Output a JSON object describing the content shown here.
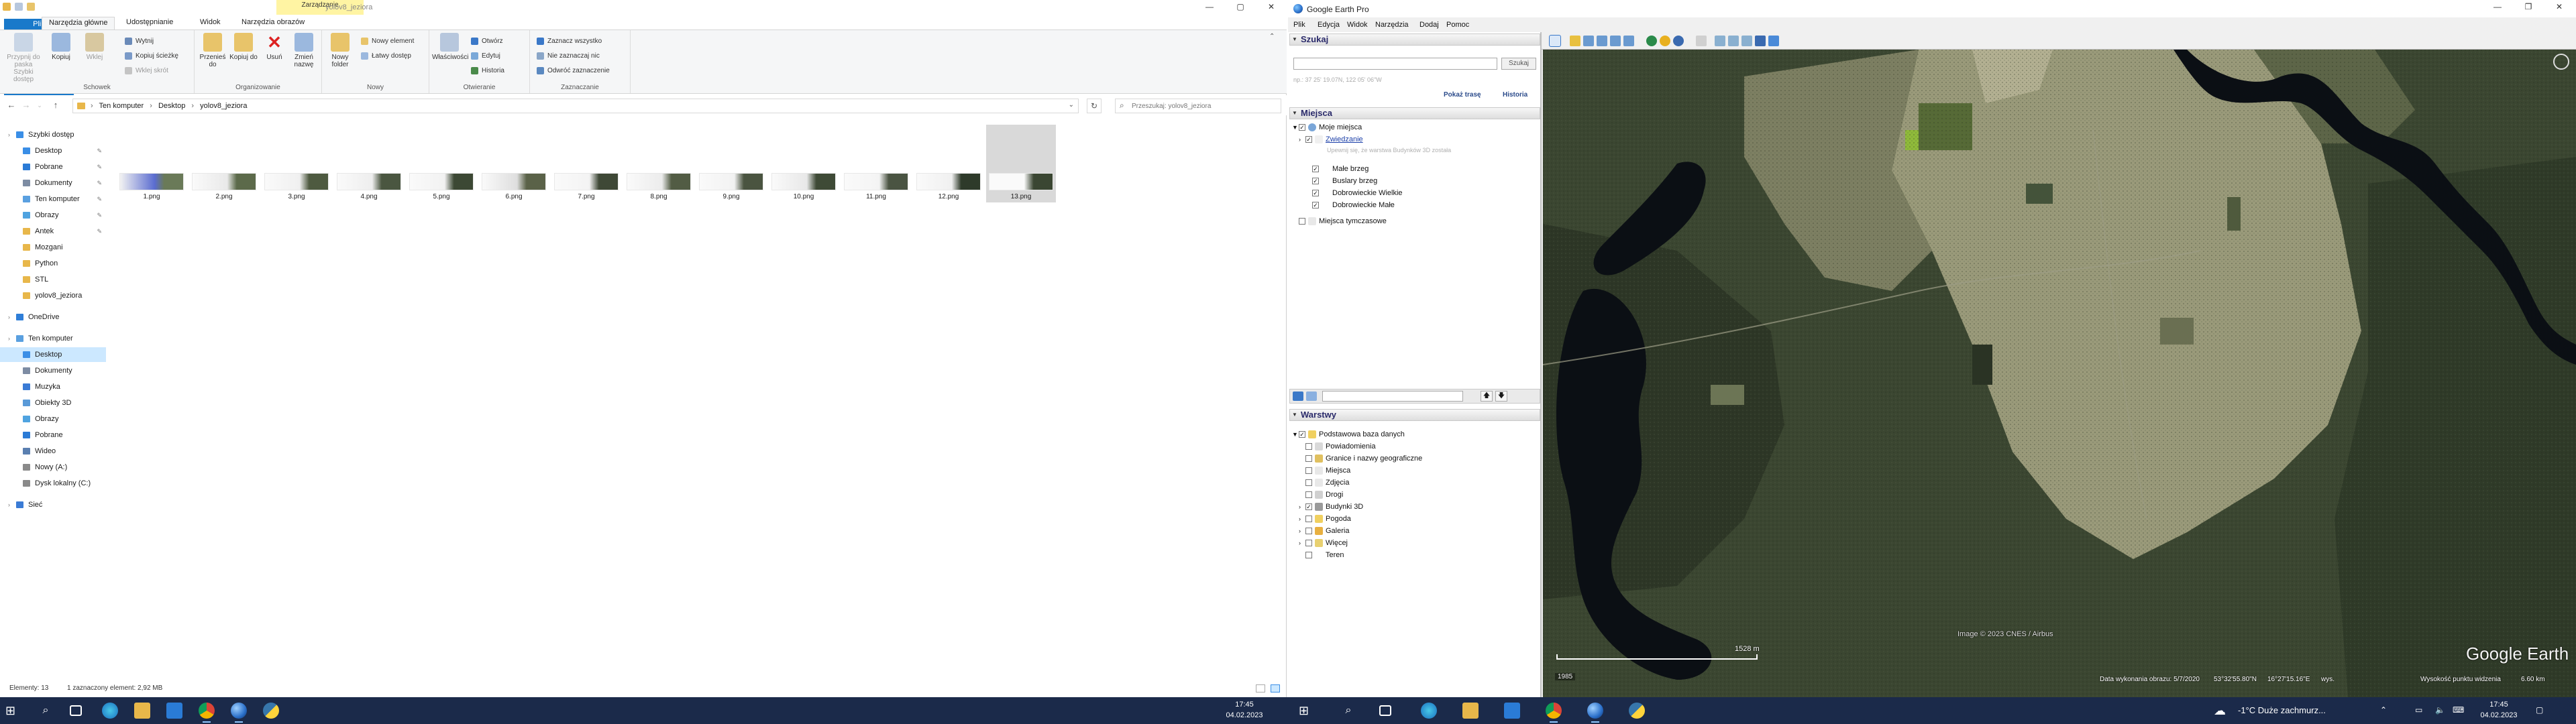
{
  "explorer": {
    "context_tab": "Zarządzanie",
    "window_title": "yolov8_jeziora",
    "ribbon_tabs": [
      "Plik",
      "Narzędzia główne",
      "Udostępnianie",
      "Widok",
      "Narzędzia obrazów"
    ],
    "ribbon": {
      "schowek": {
        "label": "Schowek",
        "pin_label": "Przypnij do paska Szybki dostęp",
        "copy_label": "Kopiuj",
        "paste_label": "Wklej",
        "cut_label": "Wytnij",
        "copy_path_label": "Kopiuj ścieżkę",
        "paste_shortcut_label": "Wklej skrót"
      },
      "organizowanie": {
        "label": "Organizowanie",
        "move_label": "Przenieś do",
        "copyto_label": "Kopiuj do",
        "delete_label": "Usuń",
        "rename_label": "Zmień nazwę"
      },
      "nowy": {
        "label": "Nowy",
        "new_folder_label": "Nowy folder",
        "new_item_label": "Nowy element",
        "easy_access_label": "Łatwy dostęp"
      },
      "otwieranie": {
        "label": "Otwieranie",
        "properties_label": "Właściwości",
        "open_label": "Otwórz",
        "edit_label": "Edytuj",
        "history_label": "Historia"
      },
      "zaznaczanie": {
        "label": "Zaznaczanie",
        "select_all_label": "Zaznacz wszystko",
        "select_none_label": "Nie zaznaczaj nic",
        "invert_label": "Odwróć zaznaczenie"
      }
    },
    "address": {
      "crumbs": [
        "Ten komputer",
        "Desktop",
        "yolov8_jeziora"
      ],
      "search_placeholder": "Przeszukaj: yolov8_jeziora"
    },
    "nav": [
      {
        "label": "Szybki dostęp",
        "level": 0,
        "color": "#3a8ee6",
        "pin": false
      },
      {
        "label": "Desktop",
        "level": 1,
        "color": "#3a8ee6",
        "pin": true
      },
      {
        "label": "Pobrane",
        "level": 1,
        "color": "#2b7bd6",
        "pin": true
      },
      {
        "label": "Dokumenty",
        "level": 1,
        "color": "#7d8ca3",
        "pin": true
      },
      {
        "label": "Ten komputer",
        "level": 1,
        "color": "#5aa0e0",
        "pin": true
      },
      {
        "label": "Obrazy",
        "level": 1,
        "color": "#4fa3e0",
        "pin": true
      },
      {
        "label": "Antek",
        "level": 1,
        "color": "#e8b74a",
        "pin": true
      },
      {
        "label": "Mozgani",
        "level": 1,
        "color": "#e8b74a",
        "pin": false
      },
      {
        "label": "Python",
        "level": 1,
        "color": "#e8b74a",
        "pin": false
      },
      {
        "label": "STL",
        "level": 1,
        "color": "#e8b74a",
        "pin": false
      },
      {
        "label": "yolov8_jeziora",
        "level": 1,
        "color": "#e8b74a",
        "pin": false
      },
      {
        "label": "OneDrive",
        "level": 0,
        "color": "#2f7ed8",
        "pin": false
      },
      {
        "label": "Ten komputer",
        "level": 0,
        "color": "#5aa0e0",
        "pin": false
      },
      {
        "label": "Desktop",
        "level": 1,
        "color": "#3a8ee6",
        "pin": false,
        "selected": true
      },
      {
        "label": "Dokumenty",
        "level": 1,
        "color": "#7d8ca3",
        "pin": false
      },
      {
        "label": "Muzyka",
        "level": 1,
        "color": "#3a7bd5",
        "pin": false
      },
      {
        "label": "Obiekty 3D",
        "level": 1,
        "color": "#5a9ad8",
        "pin": false
      },
      {
        "label": "Obrazy",
        "level": 1,
        "color": "#4fa3e0",
        "pin": false
      },
      {
        "label": "Pobrane",
        "level": 1,
        "color": "#2b7bd6",
        "pin": false
      },
      {
        "label": "Wideo",
        "level": 1,
        "color": "#5a7fb0",
        "pin": false
      },
      {
        "label": "Nowy (A:)",
        "level": 1,
        "color": "#8a8a8a",
        "pin": false
      },
      {
        "label": "Dysk lokalny (C:)",
        "level": 1,
        "color": "#8a8a8a",
        "pin": false
      },
      {
        "label": "Sieć",
        "level": 0,
        "color": "#3a7bd5",
        "pin": false
      }
    ],
    "files": [
      "1.png",
      "2.png",
      "3.png",
      "4.png",
      "5.png",
      "6.png",
      "7.png",
      "8.png",
      "9.png",
      "10.png",
      "11.png",
      "12.png",
      "13.png"
    ],
    "status": {
      "count": "Elementy: 13",
      "selection": "1 zaznaczony element: 2,92 MB"
    }
  },
  "earth": {
    "title": "Google Earth Pro",
    "menu": [
      "Plik",
      "Edycja",
      "Widok",
      "Narzędzia",
      "Dodaj",
      "Pomoc"
    ],
    "search": {
      "header": "Szukaj",
      "button": "Szukaj",
      "example": "np.: 37 25' 19.07N, 122 05' 06\"W",
      "tour_link": "Pokaż trasę",
      "history_link": "Historia"
    },
    "places": {
      "header": "Miejsca",
      "my_places": "Moje miejsca",
      "tour": "Zwiedzanie",
      "tour_hint": "Upewnij się, że warstwa Budynków 3D została",
      "items": [
        "Małe brzeg",
        "Buslary brzeg",
        "Dobrowieckie Wielkie",
        "Dobrowieckie Małe"
      ],
      "temp": "Miejsca tymczasowe"
    },
    "layers": {
      "header": "Warstwy",
      "root": "Podstawowa baza danych",
      "items": [
        "Powiadomienia",
        "Granice i nazwy geograficzne",
        "Miejsca",
        "Zdjęcia",
        "Drogi",
        "Budynki 3D",
        "Pogoda",
        "Galeria",
        "Więcej",
        "Teren"
      ]
    },
    "map": {
      "attribution": "Image © 2023 CNES / Airbus",
      "scale": "1528 m",
      "imagery_date": "Data wykonania obrazu: 5/7/2020",
      "lat": "53°32'55.80\"N",
      "lon": "16°27'15.16\"E",
      "elev_label": "wys.",
      "eye_alt": "Wysokość punktu widzenia",
      "eye_val": "6.60 km",
      "watermark": "Google Earth",
      "year": "1985"
    }
  },
  "taskbar": {
    "clock_time": "17:45",
    "clock_date": "04.02.2023",
    "weather": "-1°C  Duże zachmurz..."
  }
}
